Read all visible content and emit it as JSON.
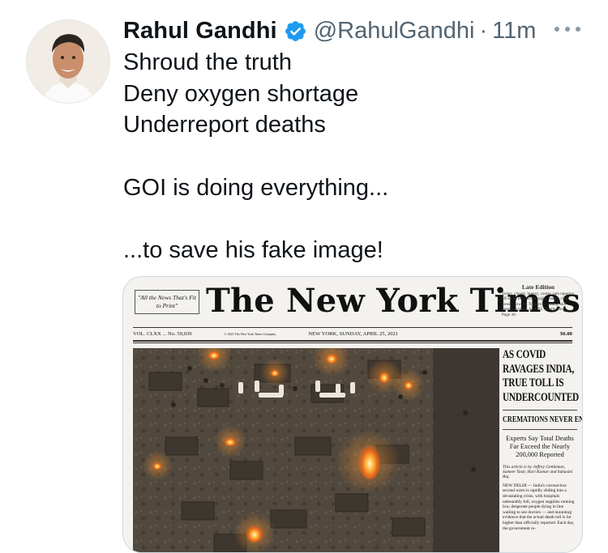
{
  "tweet": {
    "author_name": "Rahul Gandhi",
    "handle": "@RahulGandhi",
    "separator": "·",
    "time_ago": "11m",
    "verified": true,
    "lines": [
      "Shroud the truth",
      "Deny oxygen shortage",
      "Underreport deaths",
      "",
      "GOI is doing everything...",
      "",
      "...to save his fake image!"
    ]
  },
  "icons": {
    "verified": "verified-badge-icon",
    "more": "more-options-icon"
  },
  "colors": {
    "verified_blue": "#1d9bf0",
    "secondary_text": "#536471",
    "primary_text": "#0f1419",
    "card_border": "#cfd9de"
  },
  "newspaper": {
    "ear": "\"All the News That's Fit to Print\"",
    "masthead": "The New York Times",
    "edition": "Late Edition",
    "weather": "Today, cloudy, breezy, cooler, rain tapering off early, high 64. Tonight, mainly clear, breezy, low 44. Tomorrow, sunny, still breezy at times, high 63. Weather map, Page 30.",
    "volume": "VOL. CLXX ... No. 59,039",
    "copyright": "© 2021 The New York Times Company",
    "dateline": "NEW YORK, SUNDAY, APRIL 25, 2021",
    "price": "$6.00",
    "headline": "AS COVID RAVAGES INDIA, TRUE TOLL IS UNDERCOUNTED",
    "subhead": "CREMATIONS NEVER END",
    "deck": "Experts Say Total Deaths Far Exceed the Nearly 200,000 Reported",
    "byline": "This article is by Jeffrey Gettleman, Sameer Yasir, Hari Kumar and Suhasini Raj.",
    "body": "NEW DELHI — India's coronavirus second wave is rapidly sliding into a devastating crisis, with hospitals unbearably full, oxygen supplies running low, desperate people dying in line waiting to see doctors — and mounting evidence that the actual death toll is far higher than officially reported. Each day, the government re-"
  }
}
